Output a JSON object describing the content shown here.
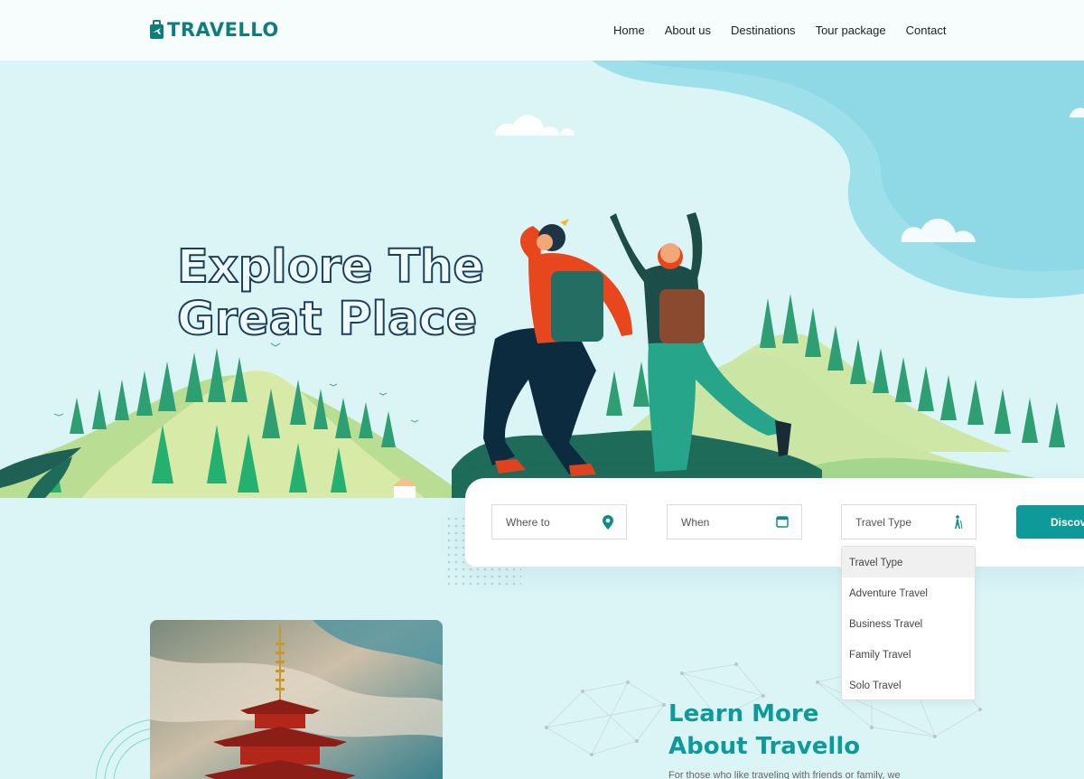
{
  "brand": {
    "name": "TRAVELLO",
    "color": "#0f7c7d",
    "accent": "#0f9a9a"
  },
  "nav": [
    {
      "label": "Home"
    },
    {
      "label": "About us"
    },
    {
      "label": "Destinations"
    },
    {
      "label": "Tour package"
    },
    {
      "label": "Contact"
    }
  ],
  "hero": {
    "headline_line1": "Explore The",
    "headline_line2": "Great Place"
  },
  "search": {
    "where_label": "Where to",
    "where_icon": "map-pin-icon",
    "when_label": "When",
    "when_icon": "calendar-icon",
    "type_label": "Travel Type",
    "type_icon": "hiker-icon",
    "button_label": "Discover"
  },
  "travel_type_options": [
    {
      "label": "Travel Type",
      "selected": true
    },
    {
      "label": "Adventure Travel"
    },
    {
      "label": "Business Travel"
    },
    {
      "label": "Family Travel"
    },
    {
      "label": "Solo Travel"
    }
  ],
  "about": {
    "title_line1": "Learn More",
    "title_line2": "About Travello",
    "text": "For those who like traveling with friends or family, we"
  }
}
